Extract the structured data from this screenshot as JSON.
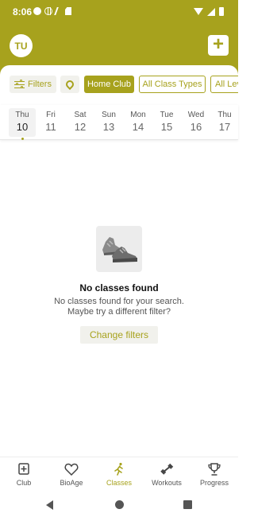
{
  "status_bar": {
    "time": "8:06"
  },
  "header": {
    "avatar_initials": "TU",
    "add_label": "+"
  },
  "filters": {
    "filters_label": "Filters",
    "club_label": "Home Club",
    "class_types_label": "All Class Types",
    "levels_label": "All Lev"
  },
  "dates": [
    {
      "name": "Thu",
      "num": "10",
      "selected": true
    },
    {
      "name": "Fri",
      "num": "11"
    },
    {
      "name": "Sat",
      "num": "12"
    },
    {
      "name": "Sun",
      "num": "13"
    },
    {
      "name": "Mon",
      "num": "14"
    },
    {
      "name": "Tue",
      "num": "15"
    },
    {
      "name": "Wed",
      "num": "16"
    },
    {
      "name": "Thu",
      "num": "17"
    }
  ],
  "empty_state": {
    "title": "No classes found",
    "message_line1": "No classes found for your search.",
    "message_line2": "Maybe try a different filter?",
    "button_label": "Change filters"
  },
  "bottom_nav": [
    {
      "label": "Club",
      "icon": "club-icon"
    },
    {
      "label": "BioAge",
      "icon": "heart-icon"
    },
    {
      "label": "Classes",
      "icon": "running-icon",
      "active": true
    },
    {
      "label": "Workouts",
      "icon": "dumbbell-icon"
    },
    {
      "label": "Progress",
      "icon": "trophy-icon"
    }
  ],
  "colors": {
    "brand": "#a7a21d",
    "chip_bg": "#f1f1ec"
  }
}
